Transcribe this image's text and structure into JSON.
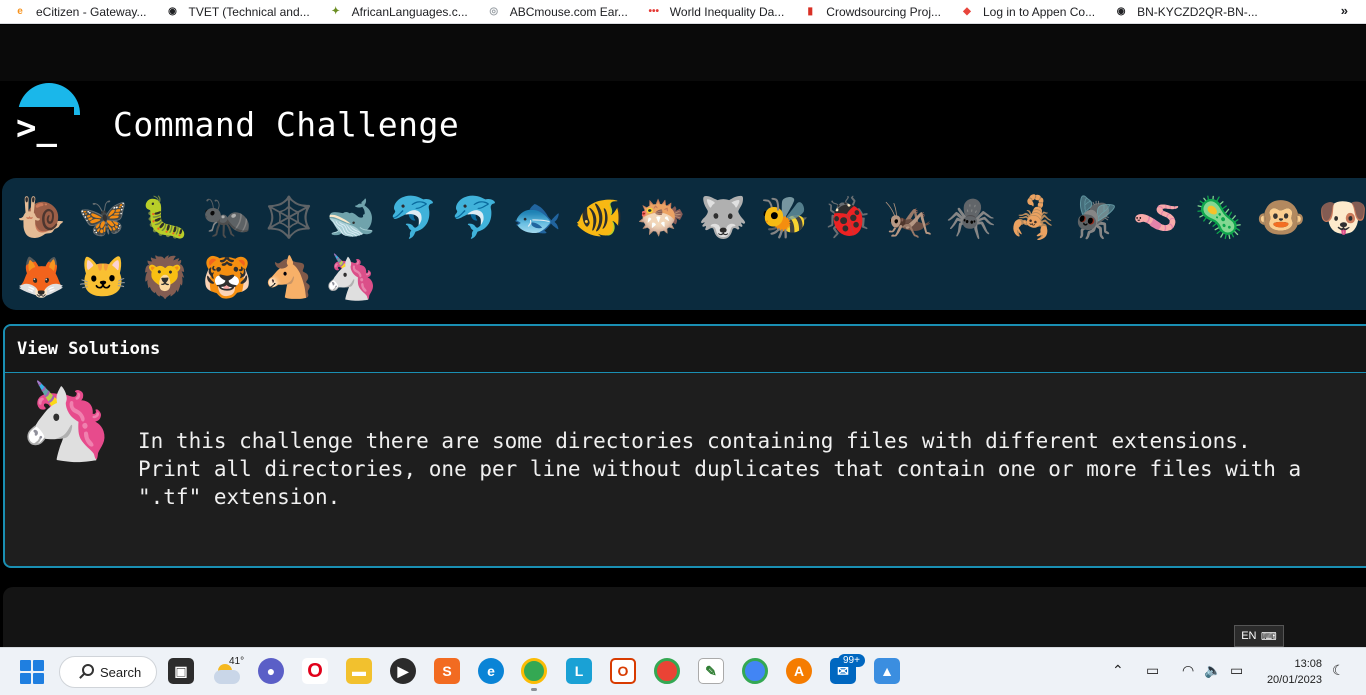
{
  "bookmarks": [
    {
      "label": "eCitizen - Gateway...",
      "icon": "ecitizen-icon",
      "color": "#f7931e",
      "glyph": "e"
    },
    {
      "label": "TVET (Technical and...",
      "icon": "globe-icon",
      "color": "#202124",
      "glyph": "◉"
    },
    {
      "label": "AfricanLanguages.c...",
      "icon": "africa-icon",
      "color": "#6b8e23",
      "glyph": "✦"
    },
    {
      "label": "ABCmouse.com Ear...",
      "icon": "mouse-icon",
      "color": "#9aa0a6",
      "glyph": "◎"
    },
    {
      "label": "World Inequality Da...",
      "icon": "dots-icon",
      "color": "#e53935",
      "glyph": "•••"
    },
    {
      "label": "Crowdsourcing Proj...",
      "icon": "crowd-icon",
      "color": "#d93025",
      "glyph": "▮"
    },
    {
      "label": "Log in to Appen Co...",
      "icon": "appen-icon",
      "color": "#e8453c",
      "glyph": "◆"
    },
    {
      "label": "BN-KYCZD2QR-BN-...",
      "icon": "globe-icon",
      "color": "#202124",
      "glyph": "◉"
    }
  ],
  "bookmarks_more": "»",
  "app": {
    "logo_glyph": ">_",
    "title": "Command Challenge"
  },
  "animals": [
    "🐌",
    "🦋",
    "🐛",
    "🐜",
    "🕸️",
    "🐋",
    "🐬",
    "🐬",
    "🐟",
    "🐠",
    "🐡",
    "🐺",
    "🐝",
    "🐞",
    "🦗",
    "🕷️",
    "🦂",
    "🪰",
    "🪱",
    "🦠",
    "🐵",
    "🐶",
    "🦊",
    "🐱",
    "🦁",
    "🐯",
    "🐴",
    "🦄"
  ],
  "panel": {
    "header": "View Solutions",
    "icon": "🦄",
    "text": "In this challenge there are some directories containing files with different extensions.\nPrint all directories, one per line without duplicates that contain one or more files with a\n\".tf\" extension."
  },
  "taskbar": {
    "search_label": "Search",
    "temperature": "41°",
    "mail_badge": "99+",
    "lang": "EN",
    "time": "13:08",
    "date": "20/01/2023"
  }
}
